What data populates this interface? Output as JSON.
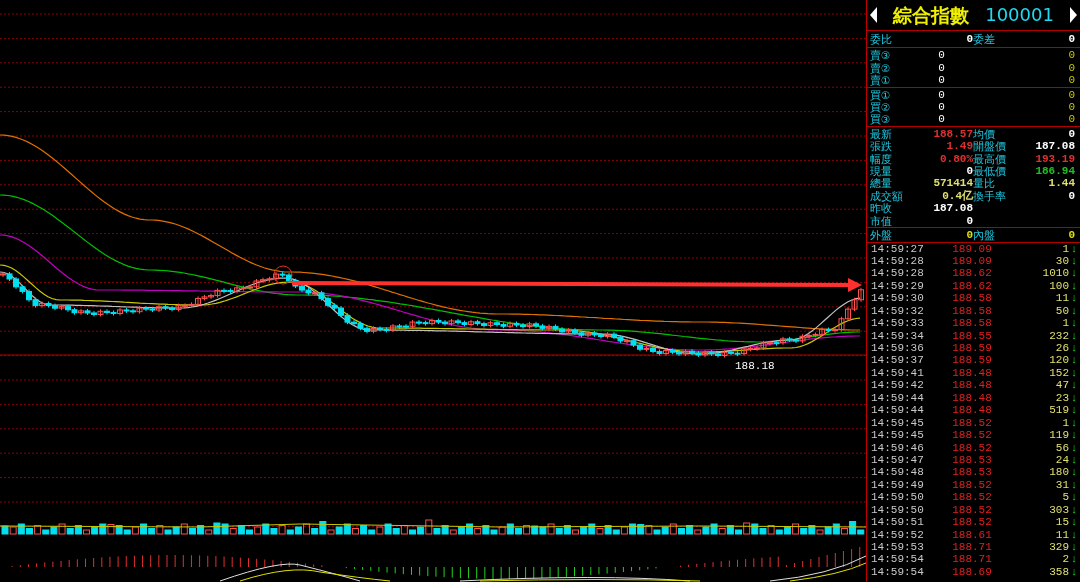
{
  "chart": {
    "low_label": "188.18"
  },
  "header": {
    "title": "綜合指數",
    "code": "100001"
  },
  "order_summary": [
    {
      "cells": [
        {
          "label": "委比",
          "value": "0",
          "color": "#ffffff"
        },
        {
          "label": "委差",
          "value": "0",
          "color": "#ffffff"
        }
      ]
    }
  ],
  "sell_orders": [
    {
      "label": "賣③",
      "price": "0",
      "volume": "0"
    },
    {
      "label": "賣②",
      "price": "0",
      "volume": "0"
    },
    {
      "label": "賣①",
      "price": "0",
      "volume": "0"
    }
  ],
  "buy_orders": [
    {
      "label": "買①",
      "price": "0",
      "volume": "0"
    },
    {
      "label": "買②",
      "price": "0",
      "volume": "0"
    },
    {
      "label": "買③",
      "price": "0",
      "volume": "0"
    }
  ],
  "stats": [
    {
      "cells": [
        {
          "label": "最新",
          "value": "188.57",
          "color": "#e03030"
        },
        {
          "label": "均價",
          "value": "0",
          "color": "#ffffff"
        }
      ]
    },
    {
      "cells": [
        {
          "label": "張跌",
          "value": "1.49",
          "color": "#e03030"
        },
        {
          "label": "開盤價",
          "value": "187.08",
          "color": "#ffffff"
        }
      ]
    },
    {
      "cells": [
        {
          "label": "幅度",
          "value": "0.80%",
          "color": "#e03030"
        },
        {
          "label": "最高價",
          "value": "193.19",
          "color": "#e03030"
        }
      ]
    },
    {
      "cells": [
        {
          "label": "現量",
          "value": "0",
          "color": "#ffffff"
        },
        {
          "label": "最低價",
          "value": "186.94",
          "color": "#20c020"
        }
      ]
    },
    {
      "cells": [
        {
          "label": "總量",
          "value": "571414",
          "color": "#e0e070"
        },
        {
          "label": "量比",
          "value": "1.44",
          "color": "#e0e070"
        }
      ]
    },
    {
      "cells": [
        {
          "label": "成交額",
          "value": "0.4亿",
          "color": "#e0e070"
        },
        {
          "label": "換手率",
          "value": "0",
          "color": "#ffffff"
        }
      ]
    },
    {
      "cells": [
        {
          "label": "昨收",
          "value": "187.08",
          "color": "#ffffff"
        }
      ]
    },
    {
      "cells": [
        {
          "label": "市值",
          "value": "0",
          "color": "#ffffff"
        }
      ]
    }
  ],
  "trade_balance": [
    {
      "cells": [
        {
          "label": "外盤",
          "value": "0",
          "color": "#e0e000"
        },
        {
          "label": "內盤",
          "value": "0",
          "color": "#e0e000"
        }
      ]
    }
  ],
  "ticks": [
    {
      "time": "14:59:27",
      "price": "189.09",
      "volume": "1",
      "arrow": "↓"
    },
    {
      "time": "14:59:28",
      "price": "189.09",
      "volume": "30",
      "arrow": "↓"
    },
    {
      "time": "14:59:28",
      "price": "188.62",
      "volume": "1010",
      "arrow": "↓"
    },
    {
      "time": "14:59:29",
      "price": "188.62",
      "volume": "100",
      "arrow": "↓"
    },
    {
      "time": "14:59:30",
      "price": "188.58",
      "volume": "11",
      "arrow": "↓"
    },
    {
      "time": "14:59:32",
      "price": "188.58",
      "volume": "50",
      "arrow": "↓"
    },
    {
      "time": "14:59:33",
      "price": "188.58",
      "volume": "1",
      "arrow": "↓"
    },
    {
      "time": "14:59:34",
      "price": "188.55",
      "volume": "232",
      "arrow": "↓"
    },
    {
      "time": "14:59:36",
      "price": "188.59",
      "volume": "26",
      "arrow": "↓"
    },
    {
      "time": "14:59:37",
      "price": "188.59",
      "volume": "120",
      "arrow": "↓"
    },
    {
      "time": "14:59:41",
      "price": "188.48",
      "volume": "152",
      "arrow": "↓"
    },
    {
      "time": "14:59:42",
      "price": "188.48",
      "volume": "47",
      "arrow": "↓"
    },
    {
      "time": "14:59:44",
      "price": "188.48",
      "volume": "23",
      "arrow": "↓"
    },
    {
      "time": "14:59:44",
      "price": "188.48",
      "volume": "519",
      "arrow": "↓"
    },
    {
      "time": "14:59:45",
      "price": "188.52",
      "volume": "1",
      "arrow": "↓"
    },
    {
      "time": "14:59:45",
      "price": "188.52",
      "volume": "119",
      "arrow": "↓"
    },
    {
      "time": "14:59:46",
      "price": "188.52",
      "volume": "56",
      "arrow": "↓"
    },
    {
      "time": "14:59:47",
      "price": "188.53",
      "volume": "24",
      "arrow": "↓"
    },
    {
      "time": "14:59:48",
      "price": "188.53",
      "volume": "180",
      "arrow": "↓"
    },
    {
      "time": "14:59:49",
      "price": "188.52",
      "volume": "31",
      "arrow": "↓"
    },
    {
      "time": "14:59:50",
      "price": "188.52",
      "volume": "5",
      "arrow": "↓"
    },
    {
      "time": "14:59:50",
      "price": "188.52",
      "volume": "303",
      "arrow": "↓"
    },
    {
      "time": "14:59:51",
      "price": "188.52",
      "volume": "15",
      "arrow": "↓"
    },
    {
      "time": "14:59:52",
      "price": "188.61",
      "volume": "11",
      "arrow": "↓"
    },
    {
      "time": "14:59:53",
      "price": "188.71",
      "volume": "329",
      "arrow": "↓"
    },
    {
      "time": "14:59:54",
      "price": "188.71",
      "volume": "2",
      "arrow": "↓"
    },
    {
      "time": "14:59:54",
      "price": "188.69",
      "volume": "358",
      "arrow": "↓"
    }
  ]
}
